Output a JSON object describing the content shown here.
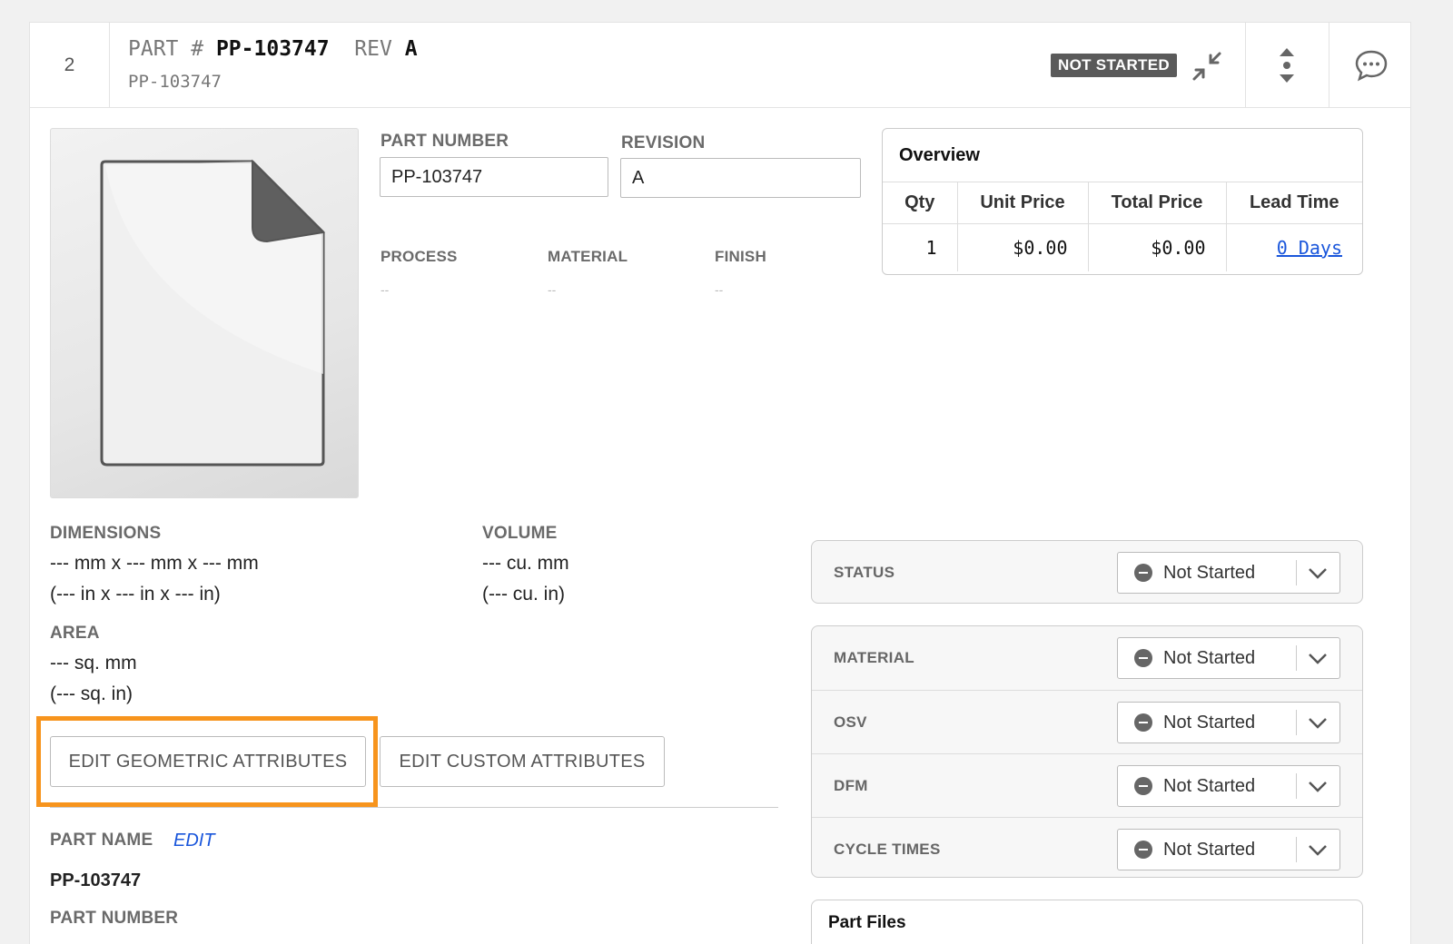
{
  "header": {
    "index": "2",
    "part_label": "PART #",
    "part_number": "PP-103747",
    "rev_label": "REV",
    "rev": "A",
    "subtitle": "PP-103747",
    "status_badge": "NOT STARTED"
  },
  "fields": {
    "part_number_label": "PART NUMBER",
    "part_number_value": "PP-103747",
    "revision_label": "REVISION",
    "revision_value": "A",
    "process_label": "PROCESS",
    "process_value": "--",
    "material_label": "MATERIAL",
    "material_value": "--",
    "finish_label": "FINISH",
    "finish_value": "--"
  },
  "overview": {
    "title": "Overview",
    "columns": [
      "Qty",
      "Unit Price",
      "Total Price",
      "Lead Time"
    ],
    "row": {
      "qty": "1",
      "unit_price": "$0.00",
      "total_price": "$0.00",
      "lead_time": "0 Days"
    }
  },
  "geometry": {
    "dimensions_label": "DIMENSIONS",
    "dimensions_mm": "--- mm x --- mm x --- mm",
    "dimensions_in": "(--- in x --- in x --- in)",
    "volume_label": "VOLUME",
    "volume_mm": "--- cu. mm",
    "volume_in": "(--- cu. in)",
    "area_label": "AREA",
    "area_mm": "--- sq. mm",
    "area_in": "(--- sq. in)"
  },
  "buttons": {
    "edit_geometric": "EDIT GEOMETRIC ATTRIBUTES",
    "edit_custom": "EDIT CUSTOM ATTRIBUTES"
  },
  "part_info": {
    "part_name_label": "PART NAME",
    "edit_link": "EDIT",
    "part_name_value": "PP-103747",
    "part_number_label": "PART NUMBER"
  },
  "status_panel": {
    "status_label": "STATUS",
    "status_value": "Not Started"
  },
  "steps": [
    {
      "label": "MATERIAL",
      "value": "Not Started"
    },
    {
      "label": "OSV",
      "value": "Not Started"
    },
    {
      "label": "DFM",
      "value": "Not Started"
    },
    {
      "label": "CYCLE TIMES",
      "value": "Not Started"
    }
  ],
  "files": {
    "title": "Part Files"
  },
  "colors": {
    "highlight": "#f7941d",
    "link": "#1a56db",
    "badge_bg": "#5a5a5a"
  }
}
